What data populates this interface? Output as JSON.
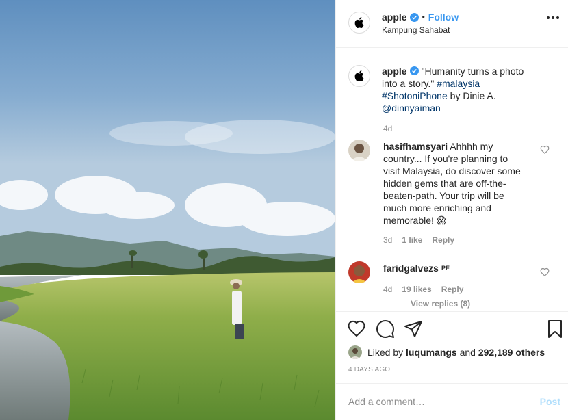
{
  "post": {
    "username": "apple",
    "location": "Kampung Sahabat",
    "follow_label": "Follow",
    "dot": "•"
  },
  "caption": {
    "username": "apple",
    "text": "\"Humanity turns a photo into a story.\"",
    "hashtag1": "#malaysia",
    "hashtag2": "#ShotoniPhone",
    "by": "by Dinie A.",
    "mention": "@dinnyaiman",
    "time": "4d"
  },
  "comments": [
    {
      "username": "hasifhamsyari",
      "text": "Ahhhh my country... If you're planning to visit Malaysia, do discover some hidden gems that are off-the-beaten-path. Your trip will be much more enriching and memorable! 😱",
      "time": "3d",
      "likes": "1 like",
      "reply": "Reply"
    },
    {
      "username": "faridgalvezs",
      "badge": "PE",
      "text": "",
      "time": "4d",
      "likes": "19 likes",
      "reply": "Reply",
      "view_replies": "View replies (8)"
    }
  ],
  "likes": {
    "prefix": "Liked by",
    "user": "luqumangs",
    "middle": "and",
    "count": "292,189 others"
  },
  "timestamp": "4 DAYS AGO",
  "add_comment": {
    "placeholder": "Add a comment…",
    "post_label": "Post"
  },
  "colors": {
    "link": "#3897f0",
    "hashtag": "#003569",
    "muted": "#8e8e8e",
    "post_disabled": "#b2dffc"
  },
  "icons": [
    "apple-logo-icon",
    "verified-icon",
    "more-options-icon",
    "heart-icon",
    "comment-icon",
    "share-icon",
    "bookmark-icon"
  ]
}
